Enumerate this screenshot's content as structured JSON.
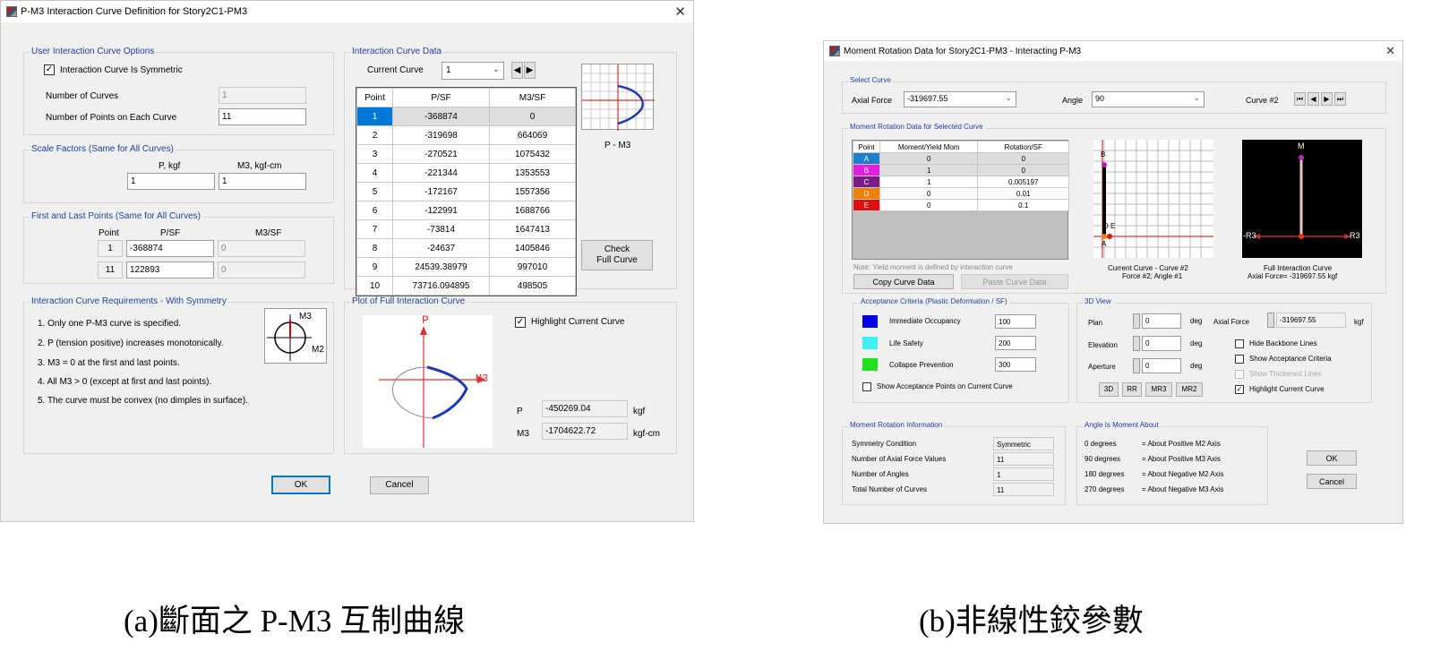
{
  "d1": {
    "title": "P-M3 Interaction Curve Definition for Story2C1-PM3",
    "opts": {
      "title": "User Interaction Curve Options",
      "sym": "Interaction Curve Is Symmetric",
      "num_curves_label": "Number of Curves",
      "num_curves": "1",
      "num_points_label": "Number of Points on Each Curve",
      "num_points": "11"
    },
    "scale": {
      "title": "Scale Factors (Same for All Curves)",
      "p_label": "P, kgf",
      "m3_label": "M3, kgf-cm",
      "p": "1",
      "m3": "1"
    },
    "fl": {
      "title": "First and Last Points (Same for All Curves)",
      "h_point": "Point",
      "h_psf": "P/SF",
      "h_m3": "M3/SF",
      "r1_pt": "1",
      "r1_p": "-368874",
      "r1_m": "0",
      "r2_pt": "11",
      "r2_p": "122893",
      "r2_m": "0"
    },
    "req": {
      "title": "Interaction Curve Requirements - With Symmetry",
      "lines": [
        "1.  Only one P-M3 curve is specified.",
        "2.  P (tension positive) increases monotonically.",
        "3.  M3 = 0 at the first and last points.",
        "4.  All M3 > 0 (except at first and last points).",
        "5.  The curve must be convex (no dimples in surface)."
      ],
      "icon_m3": "M3",
      "icon_m2": "M2"
    },
    "icd": {
      "title": "Interaction Curve Data",
      "cur_label": "Current Curve",
      "cur_val": "1",
      "headers": [
        "Point",
        "P/SF",
        "M3/SF"
      ],
      "rows": [
        [
          "1",
          "-368874",
          "0"
        ],
        [
          "2",
          "-319698",
          "664069"
        ],
        [
          "3",
          "-270521",
          "1075432"
        ],
        [
          "4",
          "-221344",
          "1353553"
        ],
        [
          "5",
          "-172167",
          "1557356"
        ],
        [
          "6",
          "-122991",
          "1688766"
        ],
        [
          "7",
          "-73814",
          "1647413"
        ],
        [
          "8",
          "-24637",
          "1405846"
        ],
        [
          "9",
          "24539.38979",
          "997010"
        ],
        [
          "10",
          "73716.094895",
          "498505"
        ]
      ],
      "preview_caption": "P - M3",
      "check_btn": "Check Full Curve"
    },
    "plot": {
      "title": "Plot of Full Interaction Curve",
      "p_axis": "P",
      "m3_axis": "M3",
      "highlight": "Highlight Current Curve",
      "p_label": "P",
      "p_val": "-450269.04",
      "p_unit": "kgf",
      "m3_label": "M3",
      "m3_val": "-1704622.72",
      "m3_unit": "kgf-cm"
    },
    "ok": "OK",
    "cancel": "Cancel"
  },
  "d2": {
    "title": "Moment Rotation Data for Story2C1-PM3 - Interacting P-M3",
    "sc": {
      "title": "Select Curve",
      "axial_label": "Axial Force",
      "axial": "-319697.55",
      "angle_label": "Angle",
      "angle": "90",
      "curve_label": "Curve #2"
    },
    "mr": {
      "title": "Moment Rotation Data for Selected Curve",
      "headers": [
        "Point",
        "Moment/Yield Mom",
        "Rotation/SF"
      ],
      "rows": [
        [
          "A",
          "0",
          "0"
        ],
        [
          "B",
          "1",
          "0"
        ],
        [
          "C",
          "1",
          "0.005197"
        ],
        [
          "D",
          "0",
          "0.01"
        ],
        [
          "E",
          "0",
          "0.1"
        ]
      ],
      "colors": [
        "#1e7fd0",
        "#e020e0",
        "#7a1a8a",
        "#f08000",
        "#e01010"
      ],
      "note": "Note:  Yield moment is defined by interaction curve",
      "copy": "Copy Curve Data",
      "paste": "Paste Curve Data",
      "cap1a": "Current Curve - Curve #2",
      "cap1b": "Force #2;  Angle #1",
      "cap2a": "Full Interaction Curve",
      "cap2b": "Axial Force= -319697.55  kgf",
      "pt_b": "B",
      "pt_de": "D E",
      "pt_a": "A",
      "m_lbl": "M",
      "r3l": "-R3",
      "r3r": "R3"
    },
    "ac": {
      "title": "Acceptance Criteria (Plastic Deformation / SF)",
      "items": [
        {
          "label": "Immediate Occupancy",
          "value": "100",
          "color": "#0000e0"
        },
        {
          "label": "Life Safety",
          "value": "200",
          "color": "#40f0f0"
        },
        {
          "label": "Collapse Prevention",
          "value": "300",
          "color": "#20e020"
        }
      ],
      "show": "Show Acceptance Points on Current Curve"
    },
    "v3": {
      "title": "3D View",
      "plan": "Plan",
      "plan_v": "0",
      "elev": "Elevation",
      "elev_v": "0",
      "ap": "Aperture",
      "ap_v": "0",
      "unit": "deg",
      "af": "Axial Force",
      "af_v": "-319697.55",
      "af_u": "kgf",
      "hide": "Hide Backbone Lines",
      "show_ac": "Show Acceptance Criteria",
      "thick": "Show Thickened Lines",
      "hl": "Highlight Current Curve",
      "btns": [
        "3D",
        "RR",
        "MR3",
        "MR2"
      ]
    },
    "info": {
      "title": "Moment Rotation Information",
      "sym": "Symmetry Condition",
      "sym_v": "Symmetric",
      "naf": "Number of Axial Force Values",
      "naf_v": "11",
      "nang": "Number of Angles",
      "nang_v": "1",
      "tot": "Total Number of Curves",
      "tot_v": "11"
    },
    "ang": {
      "title": "Angle Is Moment About",
      "rows": [
        [
          "0 degrees",
          "= About Positive M2 Axis"
        ],
        [
          "90 degrees",
          "= About Positive M3 Axis"
        ],
        [
          "180 degrees",
          "= About Negative M2 Axis"
        ],
        [
          "270 degrees",
          "= About Negative M3 Axis"
        ]
      ]
    },
    "ok": "OK",
    "cancel": "Cancel"
  },
  "captions": {
    "a": "(a)斷面之 P-M3 互制曲線",
    "b": "(b)非線性鉸參數"
  }
}
